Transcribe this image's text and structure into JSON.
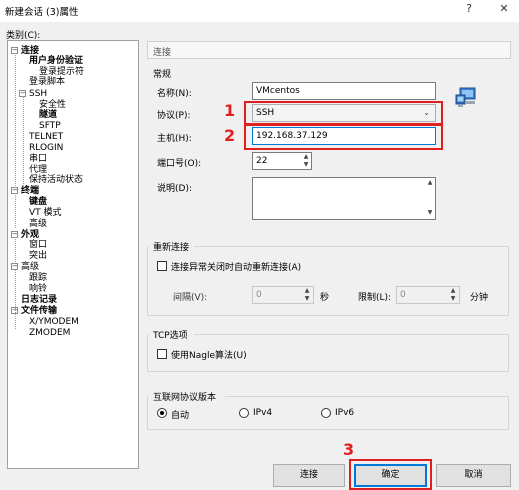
{
  "window": {
    "title": "新建会话 (3)属性",
    "help_label": "?",
    "close_label": "✕"
  },
  "category_label": "类别(C):",
  "tree": {
    "items": [
      {
        "label": "连接",
        "bold": true
      },
      {
        "label": "用户身份验证",
        "bold": true
      },
      {
        "label": "登录提示符",
        "bold": false
      },
      {
        "label": "登录脚本",
        "bold": false
      },
      {
        "label": "SSH",
        "bold": false
      },
      {
        "label": "安全性",
        "bold": false
      },
      {
        "label": "隧道",
        "bold": true
      },
      {
        "label": "SFTP",
        "bold": false
      },
      {
        "label": "TELNET",
        "bold": false
      },
      {
        "label": "RLOGIN",
        "bold": false
      },
      {
        "label": "串口",
        "bold": false
      },
      {
        "label": "代理",
        "bold": false
      },
      {
        "label": "保持活动状态",
        "bold": false
      },
      {
        "label": "终端",
        "bold": true
      },
      {
        "label": "键盘",
        "bold": true
      },
      {
        "label": "VT 模式",
        "bold": false
      },
      {
        "label": "高级",
        "bold": false
      },
      {
        "label": "外观",
        "bold": true
      },
      {
        "label": "窗口",
        "bold": false
      },
      {
        "label": "突出",
        "bold": false
      },
      {
        "label": "高级",
        "bold": false
      },
      {
        "label": "跟踪",
        "bold": false
      },
      {
        "label": "响铃",
        "bold": false
      },
      {
        "label": "日志记录",
        "bold": true
      },
      {
        "label": "文件传输",
        "bold": true
      },
      {
        "label": "X/YMODEM",
        "bold": false
      },
      {
        "label": "ZMODEM",
        "bold": false
      }
    ]
  },
  "panel": {
    "header": "连接",
    "general": {
      "title": "常规",
      "name_label": "名称(N):",
      "name_value": "VMcentos",
      "protocol_label": "协议(P):",
      "protocol_value": "SSH",
      "host_label": "主机(H):",
      "host_value": "192.168.37.129",
      "port_label": "端口号(O):",
      "port_value": "22",
      "desc_label": "说明(D):",
      "desc_value": ""
    },
    "reconnect": {
      "title": "重新连接",
      "checkbox_label": "连接异常关闭时自动重新连接(A)",
      "interval_label": "间隔(V):",
      "interval_value": "0",
      "interval_unit": "秒",
      "limit_label": "限制(L):",
      "limit_value": "0",
      "limit_unit": "分钟"
    },
    "tcp": {
      "title": "TCP选项",
      "nagle_label": "使用Nagle算法(U)"
    },
    "ipver": {
      "title": "互联网协议版本",
      "options": [
        "自动",
        "IPv4",
        "IPv6"
      ],
      "selected": "自动"
    }
  },
  "annotations": [
    "1",
    "2",
    "3"
  ],
  "buttons": {
    "connect": "连接",
    "ok": "确定",
    "cancel": "取消"
  },
  "colors": {
    "annotation_red": "#e02020",
    "primary_border": "#0078d7"
  }
}
